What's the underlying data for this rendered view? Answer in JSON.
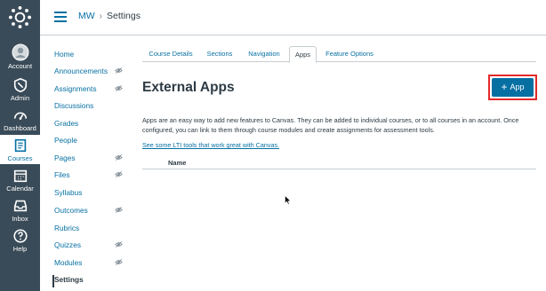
{
  "global_nav": {
    "items": [
      {
        "label": "Account",
        "icon": "account-icon"
      },
      {
        "label": "Admin",
        "icon": "admin-shield-icon"
      },
      {
        "label": "Dashboard",
        "icon": "dashboard-icon"
      },
      {
        "label": "Courses",
        "icon": "courses-book-icon",
        "active": true
      },
      {
        "label": "Calendar",
        "icon": "calendar-icon"
      },
      {
        "label": "Inbox",
        "icon": "inbox-icon"
      },
      {
        "label": "Help",
        "icon": "help-icon"
      }
    ],
    "colors": {
      "background": "#394b58",
      "active_text": "#0770a3"
    }
  },
  "breadcrumb": {
    "course": "MW",
    "separator": "›",
    "current": "Settings"
  },
  "course_nav": {
    "items": [
      {
        "label": "Home",
        "hidden": false
      },
      {
        "label": "Announcements",
        "hidden": true
      },
      {
        "label": "Assignments",
        "hidden": true
      },
      {
        "label": "Discussions",
        "hidden": false
      },
      {
        "label": "Grades",
        "hidden": false
      },
      {
        "label": "People",
        "hidden": false
      },
      {
        "label": "Pages",
        "hidden": true
      },
      {
        "label": "Files",
        "hidden": true
      },
      {
        "label": "Syllabus",
        "hidden": false
      },
      {
        "label": "Outcomes",
        "hidden": true
      },
      {
        "label": "Rubrics",
        "hidden": false
      },
      {
        "label": "Quizzes",
        "hidden": true
      },
      {
        "label": "Modules",
        "hidden": true
      },
      {
        "label": "Settings",
        "hidden": false,
        "active": true
      }
    ]
  },
  "tabs": [
    {
      "label": "Course Details"
    },
    {
      "label": "Sections"
    },
    {
      "label": "Navigation"
    },
    {
      "label": "Apps",
      "active": true
    },
    {
      "label": "Feature Options"
    }
  ],
  "main": {
    "title": "External Apps",
    "add_button_label": "App",
    "description": "Apps are an easy way to add new features to Canvas. They can be added to individual courses, or to all courses in an account. Once configured, you can link to them through course modules and create assignments for assessment tools.",
    "lti_link": "See some LTI tools that work great with Canvas.",
    "table_header": "Name"
  },
  "colors": {
    "accent": "#0770a3",
    "highlight_box": "#e22a2a",
    "text": "#2d3b45"
  }
}
